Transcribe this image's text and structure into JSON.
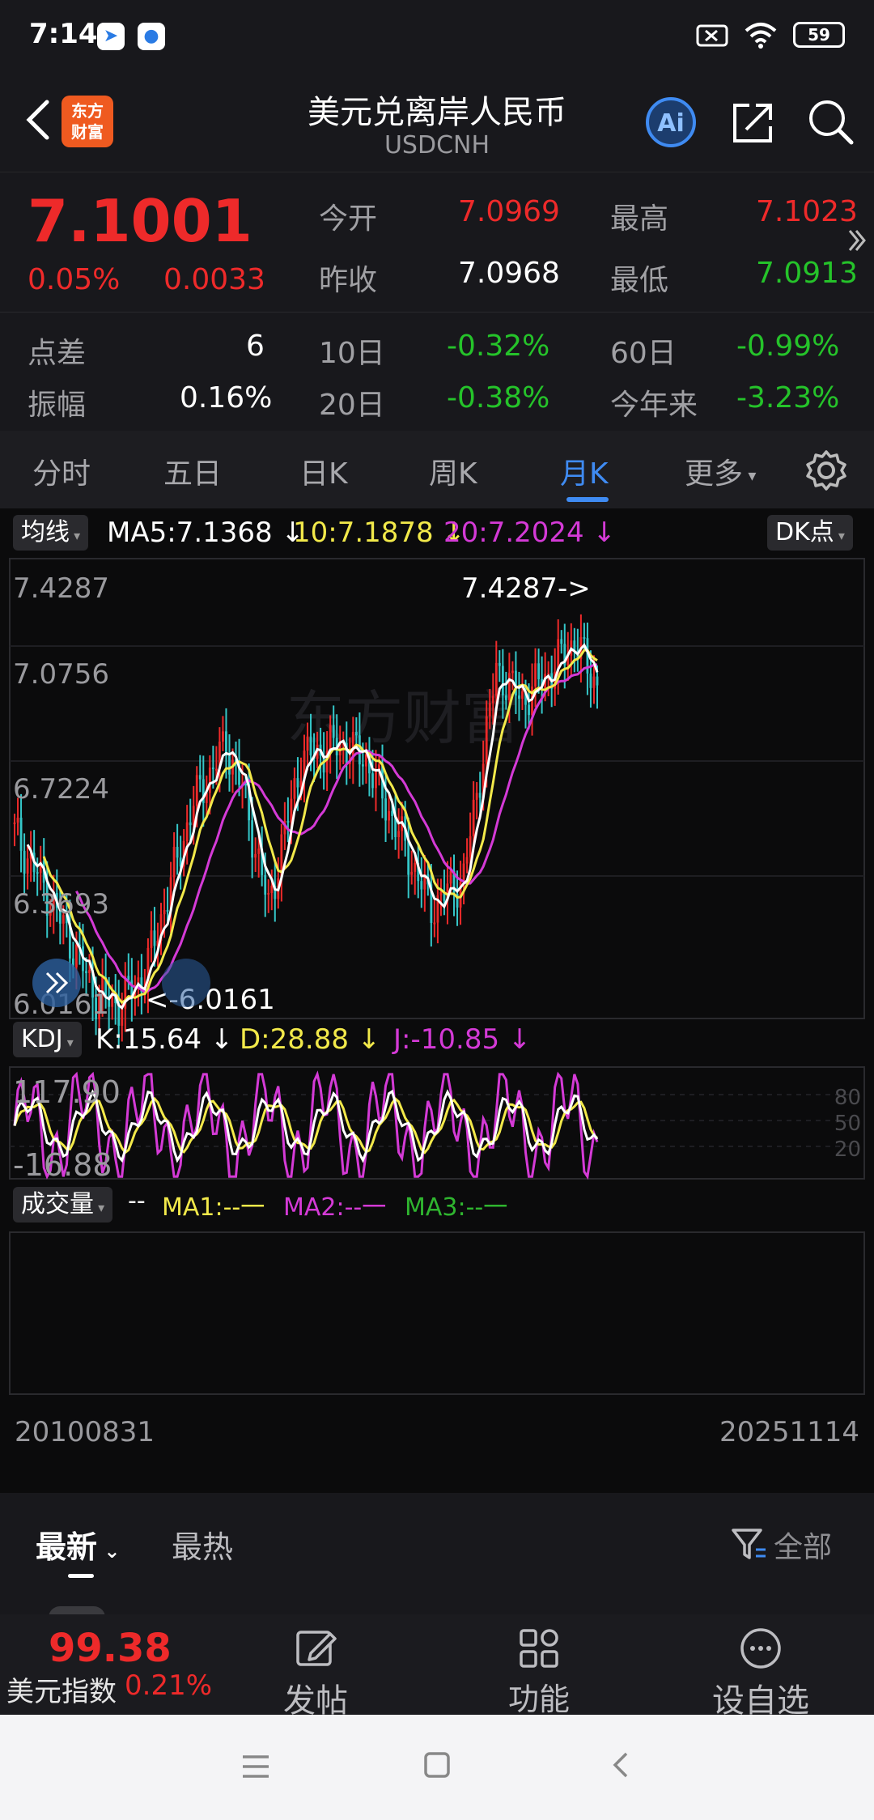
{
  "status": {
    "time": "7:14",
    "battery": "59"
  },
  "header": {
    "logo_text": "东方财富",
    "title": "美元兑离岸人民币",
    "code": "USDCNH"
  },
  "quote": {
    "price": "7.1001",
    "change_pct": "0.05%",
    "change": "0.0033",
    "open_label": "今开",
    "open": "7.0969",
    "high_label": "最高",
    "high": "7.1023",
    "prev_label": "昨收",
    "prev": "7.0968",
    "low_label": "最低",
    "low": "7.0913",
    "spread_label": "点差",
    "spread": "6",
    "d10_label": "10日",
    "d10": "-0.32%",
    "d60_label": "60日",
    "d60": "-0.99%",
    "amp_label": "振幅",
    "amp": "0.16%",
    "d20_label": "20日",
    "d20": "-0.38%",
    "ytd_label": "今年来",
    "ytd": "-3.23%"
  },
  "tabs": [
    "分时",
    "五日",
    "日K",
    "周K",
    "月K",
    "更多"
  ],
  "chart_legend": {
    "ma_button": "均线",
    "ma5": "MA5:7.1368",
    "ma10": "10:7.1878",
    "ma20": "20:7.2024",
    "dk_button": "DK点",
    "y_labels": [
      "7.4287",
      "7.0756",
      "6.7224",
      "6.3693",
      "6.0161"
    ],
    "max_marker": "7.4287->",
    "min_marker": "<-6.0161",
    "kdj_button": "KDJ",
    "k": "K:15.64",
    "d": "D:28.88",
    "j": "J:-10.85",
    "kdj_top": "117.90",
    "kdj_bottom": "-16.88",
    "kdj_levels": [
      "80",
      "50",
      "20"
    ],
    "vol_button": "成交量",
    "vol_dash": "--",
    "vma1": "MA1:--一",
    "vma2": "MA2:--一",
    "vma3": "MA3:--一",
    "date_start": "20100831",
    "date_end": "20251114"
  },
  "feed": {
    "tab_latest": "最新",
    "tab_hot": "最热",
    "filter": "全部"
  },
  "bottom": {
    "index_value": "99.38",
    "index_name": "美元指数",
    "index_change": "0.21%",
    "post": "发帖",
    "functions": "功能",
    "watch": "设自选"
  },
  "colors": {
    "up": "#ee2a2a",
    "down": "#25c32a",
    "accent": "#3f8bf2",
    "ma5": "#ffffff",
    "ma10": "#f2e94a",
    "ma20": "#d43ad6"
  }
}
